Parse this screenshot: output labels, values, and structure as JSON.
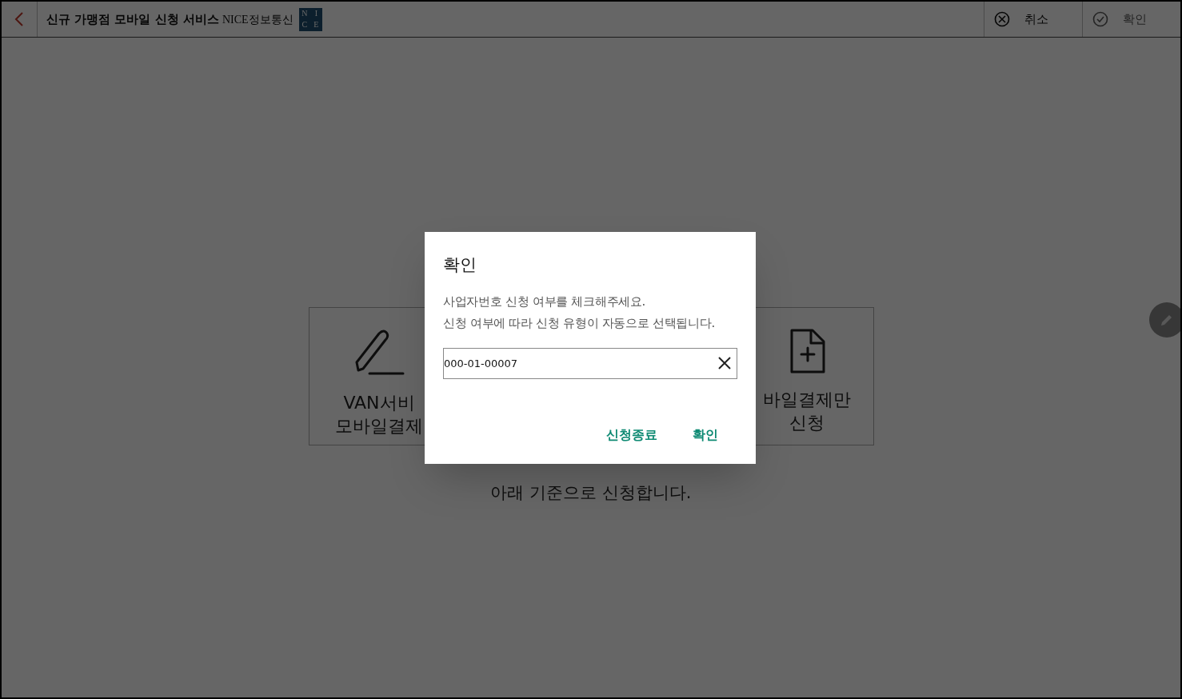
{
  "header": {
    "title": "신규 가맹점 모바일 신청 서비스",
    "brand": "NICE정보통신",
    "logo_letters": [
      "N",
      "I",
      "C",
      "E"
    ],
    "actions": [
      {
        "kind": "cancel",
        "label": "취소",
        "disabled": false
      },
      {
        "kind": "confirm",
        "label": "확인",
        "disabled": true
      }
    ]
  },
  "options": [
    {
      "kind": "pen",
      "lines": [
        "VAN서비",
        "모바일결제"
      ]
    },
    {
      "kind": "file",
      "lines": [
        "바일결제만",
        "신청"
      ]
    }
  ],
  "note": "아래 기준으로 신청합니다.",
  "dialog": {
    "title": "확인",
    "message": [
      "사업자번호 신청 여부를 체크해주세요.",
      "신청 여부에 따라 신청 유형이 자동으로 선택됩니다."
    ],
    "field": {
      "value": "000-01-00007"
    },
    "buttons": [
      "신청종료",
      "확인"
    ]
  }
}
